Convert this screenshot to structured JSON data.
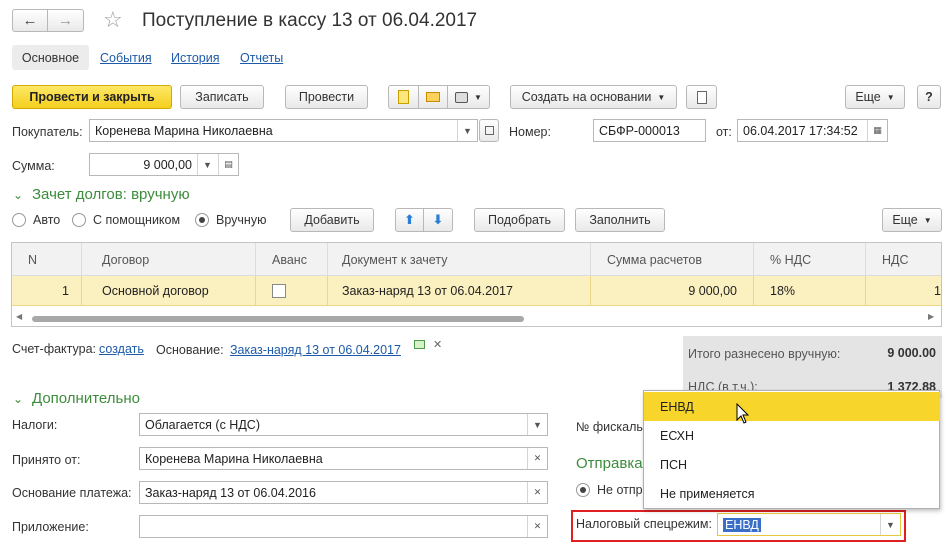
{
  "title": "Поступление в кассу 13 от 06.04.2017",
  "nav": {
    "back": "←",
    "forward": "→",
    "star": "☆"
  },
  "tabs": [
    "Основное",
    "События",
    "История",
    "Отчеты"
  ],
  "toolbar": {
    "post_close": "Провести и закрыть",
    "save": "Записать",
    "post": "Провести",
    "create_based": "Создать на основании",
    "more": "Еще",
    "help": "?"
  },
  "buyer": {
    "label": "Покупатель:",
    "value": "Коренева Марина Николаевна"
  },
  "number": {
    "label": "Номер:",
    "value": "СБФР-000013"
  },
  "date": {
    "label": "от:",
    "value": "06.04.2017 17:34:52"
  },
  "amount": {
    "label": "Сумма:",
    "value": "9 000,00"
  },
  "debts": {
    "title": "Зачет долгов: вручную",
    "radio_auto": "Авто",
    "radio_assist": "С помощником",
    "radio_manual": "Вручную",
    "add": "Добавить",
    "pick": "Подобрать",
    "fill": "Заполнить",
    "more": "Еще"
  },
  "table": {
    "headers": [
      "N",
      "Договор",
      "Аванс",
      "Документ к зачету",
      "Сумма расчетов",
      "% НДС",
      "НДС"
    ],
    "row": {
      "n": "1",
      "contract": "Основной договор",
      "doc": "Заказ-наряд 13 от 06.04.2017",
      "sum": "9 000,00",
      "vat_rate": "18%",
      "vat": "1"
    }
  },
  "invoice": {
    "label": "Счет-фактура:",
    "create_link": "создать",
    "basis_label": "Основание:",
    "basis_link": "Заказ-наряд 13 от 06.04.2017"
  },
  "totals": {
    "manual_label": "Итого разнесено вручную:",
    "manual_value": "9 000.00",
    "vat_label": "НДС (в т.ч.):",
    "vat_value": "1 372.88"
  },
  "extra": {
    "title": "Дополнительно",
    "taxes_label": "Налоги:",
    "taxes_value": "Облагается (с НДС)",
    "received_label": "Принято от:",
    "received_value": "Коренева Марина Николаевна",
    "basis_label": "Основание платежа:",
    "basis_value": "Заказ-наряд 13 от 06.04.2016",
    "attach_label": "Приложение:",
    "attach_value": "",
    "fiscal_label": "№ фискаль",
    "send_title": "Отправка",
    "no_send": "Не отпр",
    "tax_regime_label": "Налоговый спецрежим:",
    "tax_regime_value": "ЕНВД"
  },
  "dropdown": [
    "ЕНВД",
    "ЕСХН",
    "ПСН",
    "Не применяется"
  ],
  "colors": {
    "accent_yellow": "#f5cf1e",
    "green": "#3c8c3c",
    "highlight_red": "#e02020"
  }
}
